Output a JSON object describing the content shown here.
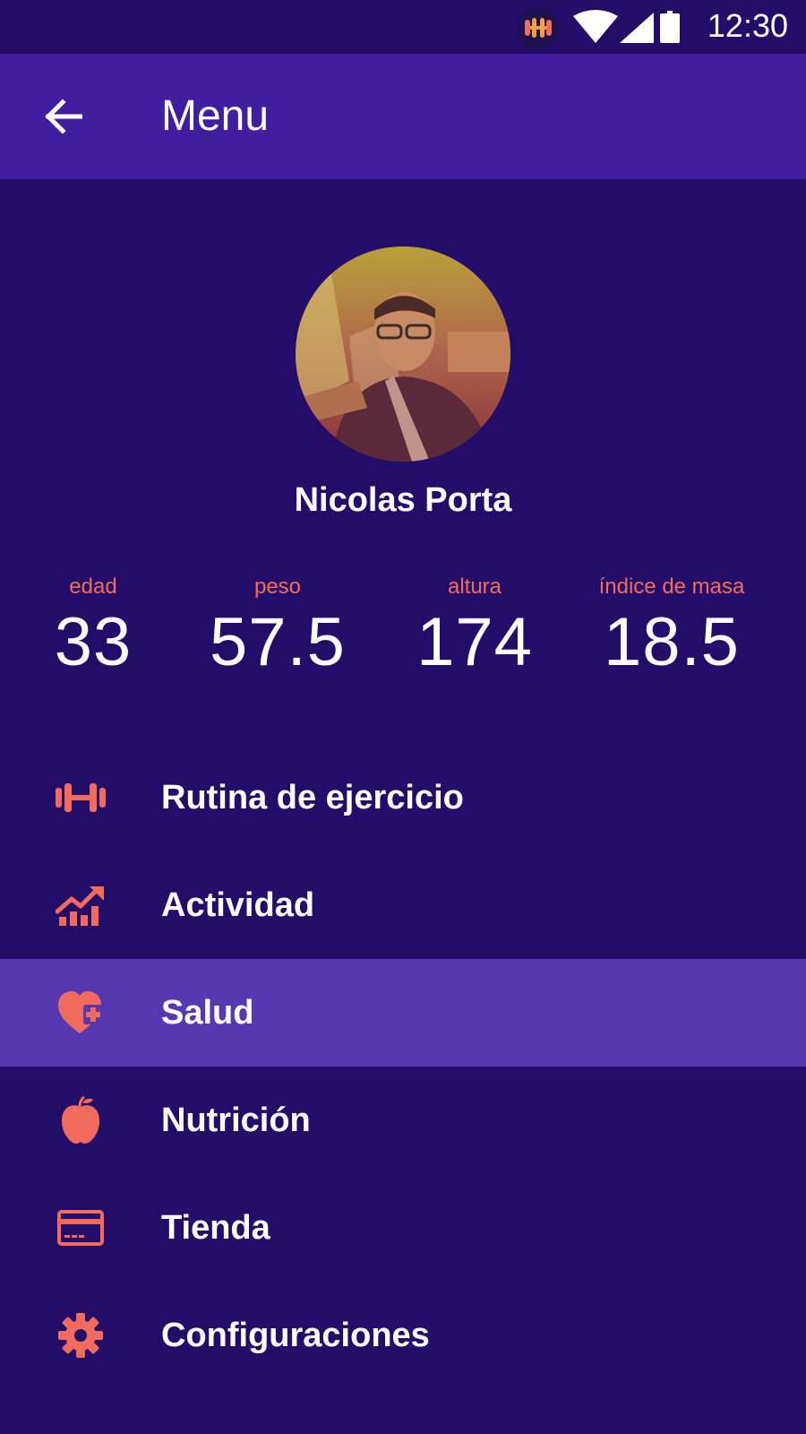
{
  "status_bar": {
    "time": "12:30",
    "icons": [
      "app-badge-icon",
      "wifi-icon",
      "cell-signal-icon",
      "battery-icon"
    ]
  },
  "app_bar": {
    "title": "Menu",
    "back_icon": "arrow-back-icon"
  },
  "profile": {
    "name": "Nicolas Porta",
    "avatar": "profile-photo"
  },
  "stats": [
    {
      "label": "edad",
      "value": "33"
    },
    {
      "label": "peso",
      "value": "57.5"
    },
    {
      "label": "altura",
      "value": "174"
    },
    {
      "label": "índice de masa",
      "value": "18.5"
    }
  ],
  "menu": {
    "items": [
      {
        "label": "Rutina de ejercicio",
        "icon": "dumbbell-icon",
        "active": false
      },
      {
        "label": "Actividad",
        "icon": "chart-growth-icon",
        "active": false
      },
      {
        "label": "Salud",
        "icon": "heart-plus-icon",
        "active": true
      },
      {
        "label": "Nutrición",
        "icon": "apple-icon",
        "active": false
      },
      {
        "label": "Tienda",
        "icon": "credit-card-icon",
        "active": false
      },
      {
        "label": "Configuraciones",
        "icon": "gear-icon",
        "active": false
      }
    ]
  },
  "colors": {
    "background": "#240d69",
    "app_bar": "#3f1ea0",
    "active_row": "#5639b1",
    "accent": "#f26b5c",
    "text": "#ffffff"
  }
}
